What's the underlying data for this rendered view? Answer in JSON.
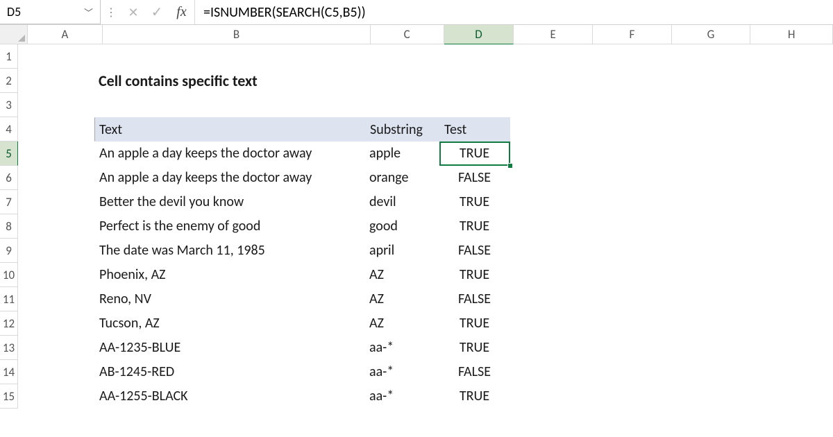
{
  "name_box": "D5",
  "formula": "=ISNUMBER(SEARCH(C5,B5))",
  "fx_label": "fx",
  "columns": [
    "A",
    "B",
    "C",
    "D",
    "E",
    "F",
    "G",
    "H"
  ],
  "active_col": "D",
  "rows": [
    "1",
    "2",
    "3",
    "4",
    "5",
    "6",
    "7",
    "8",
    "9",
    "10",
    "11",
    "12",
    "13",
    "14",
    "15"
  ],
  "active_row": "5",
  "title": "Cell contains specific text",
  "headers": {
    "text": "Text",
    "substring": "Substring",
    "test": "Test"
  },
  "chart_data": {
    "type": "table",
    "columns": [
      "Text",
      "Substring",
      "Test"
    ],
    "rows": [
      {
        "text": "An apple a day keeps the doctor away",
        "substring": "apple",
        "test": "TRUE"
      },
      {
        "text": "An apple a day keeps the doctor away",
        "substring": "orange",
        "test": "FALSE"
      },
      {
        "text": "Better the devil you know",
        "substring": "devil",
        "test": "TRUE"
      },
      {
        "text": "Perfect is the enemy of good",
        "substring": "good",
        "test": "TRUE"
      },
      {
        "text": "The date was March 11, 1985",
        "substring": "april",
        "test": "FALSE"
      },
      {
        "text": "Phoenix, AZ",
        "substring": "AZ",
        "test": "TRUE"
      },
      {
        "text": "Reno, NV",
        "substring": "AZ",
        "test": "FALSE"
      },
      {
        "text": "Tucson, AZ",
        "substring": "AZ",
        "test": "TRUE"
      },
      {
        "text": "AA-1235-BLUE",
        "substring": "aa-*",
        "test": "TRUE"
      },
      {
        "text": "AB-1245-RED",
        "substring": "aa-*",
        "test": "FALSE"
      },
      {
        "text": "AA-1255-BLACK",
        "substring": "aa-*",
        "test": "TRUE"
      }
    ]
  }
}
